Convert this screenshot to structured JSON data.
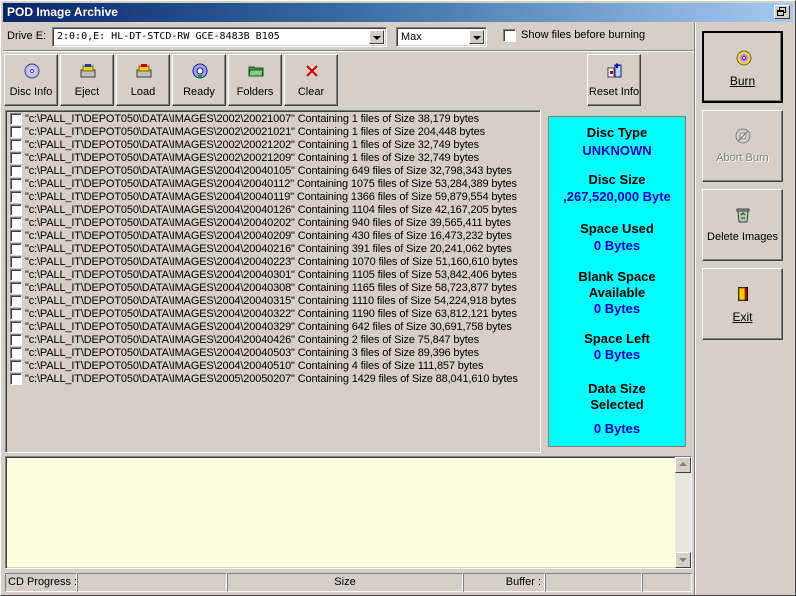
{
  "window": {
    "title": "POD Image Archive"
  },
  "drive": {
    "label": "Drive E:",
    "selected": "2:0:0,E: HL-DT-STCD-RW GCE-8483B B105"
  },
  "speed": {
    "selected": "Max"
  },
  "show_files": {
    "label": "Show files before burning",
    "checked": false
  },
  "toolbar": {
    "disc_info": "Disc Info",
    "eject": "Eject",
    "load": "Load",
    "ready": "Ready",
    "folders": "Folders",
    "clear": "Clear",
    "reset_info": "Reset Info"
  },
  "files": [
    "\"c:\\PALL_IT\\DEPOT050\\DATA\\IMAGES\\2002\\20021007\" Containing 1 files of Size 38,179 bytes",
    "\"c:\\PALL_IT\\DEPOT050\\DATA\\IMAGES\\2002\\20021021\" Containing 1 files of Size 204,448 bytes",
    "\"c:\\PALL_IT\\DEPOT050\\DATA\\IMAGES\\2002\\20021202\" Containing 1 files of Size 32,749 bytes",
    "\"c:\\PALL_IT\\DEPOT050\\DATA\\IMAGES\\2002\\20021209\" Containing 1 files of Size 32,749 bytes",
    "\"c:\\PALL_IT\\DEPOT050\\DATA\\IMAGES\\2004\\20040105\" Containing 649 files of Size 32,798,343 bytes",
    "\"c:\\PALL_IT\\DEPOT050\\DATA\\IMAGES\\2004\\20040112\" Containing 1075 files of Size 53,284,389 bytes",
    "\"c:\\PALL_IT\\DEPOT050\\DATA\\IMAGES\\2004\\20040119\" Containing 1366 files of Size 59,879,554 bytes",
    "\"c:\\PALL_IT\\DEPOT050\\DATA\\IMAGES\\2004\\20040126\" Containing 1104 files of Size 42,167,205 bytes",
    "\"c:\\PALL_IT\\DEPOT050\\DATA\\IMAGES\\2004\\20040202\" Containing 940 files of Size 39,565,411 bytes",
    "\"c:\\PALL_IT\\DEPOT050\\DATA\\IMAGES\\2004\\20040209\" Containing 430 files of Size 16,473,232 bytes",
    "\"c:\\PALL_IT\\DEPOT050\\DATA\\IMAGES\\2004\\20040216\" Containing 391 files of Size 20,241,062 bytes",
    "\"c:\\PALL_IT\\DEPOT050\\DATA\\IMAGES\\2004\\20040223\" Containing 1070 files of Size 51,160,610 bytes",
    "\"c:\\PALL_IT\\DEPOT050\\DATA\\IMAGES\\2004\\20040301\" Containing 1105 files of Size 53,842,406 bytes",
    "\"c:\\PALL_IT\\DEPOT050\\DATA\\IMAGES\\2004\\20040308\" Containing 1165 files of Size 58,723,877 bytes",
    "\"c:\\PALL_IT\\DEPOT050\\DATA\\IMAGES\\2004\\20040315\" Containing 1110 files of Size 54,224,918 bytes",
    "\"c:\\PALL_IT\\DEPOT050\\DATA\\IMAGES\\2004\\20040322\" Containing 1190 files of Size 63,812,121 bytes",
    "\"c:\\PALL_IT\\DEPOT050\\DATA\\IMAGES\\2004\\20040329\" Containing 642 files of Size 30,691,758 bytes",
    "\"c:\\PALL_IT\\DEPOT050\\DATA\\IMAGES\\2004\\20040426\" Containing 2 files of Size 75,847 bytes",
    "\"c:\\PALL_IT\\DEPOT050\\DATA\\IMAGES\\2004\\20040503\" Containing 3 files of Size 89,396 bytes",
    "\"c:\\PALL_IT\\DEPOT050\\DATA\\IMAGES\\2004\\20040510\" Containing 4 files of Size 111,857 bytes",
    "\"c:\\PALL_IT\\DEPOT050\\DATA\\IMAGES\\2005\\20050207\" Containing 1429 files of Size 88,041,610 bytes"
  ],
  "disc_panel": {
    "disc_type_label": "Disc Type",
    "disc_type_value": "UNKNOWN",
    "disc_size_label": "Disc Size",
    "disc_size_value": ",267,520,000 Byte",
    "space_used_label": "Space Used",
    "space_used_value": "0 Bytes",
    "blank_space_label_1": "Blank Space",
    "blank_space_label_2": "Available",
    "blank_space_value": "0 Bytes",
    "space_left_label": "Space Left",
    "space_left_value": "0 Bytes",
    "data_size_label_1": "Data Size",
    "data_size_label_2": "Selected",
    "data_size_value": "0 Bytes",
    "background_color": "#00ffff",
    "value_color": "#0000c0"
  },
  "side_buttons": {
    "burn": "Burn",
    "abort_burn": "Abort Burn",
    "delete_images": "Delete Images",
    "exit": "Exit"
  },
  "status": {
    "cd_progress_label": "CD Progress :",
    "size_label": "Size",
    "buffer_label": "Buffer :"
  },
  "icons": {
    "disc_info": "cd-icon",
    "eject": "eject-icon",
    "load": "load-icon",
    "ready": "cd-ready-icon",
    "folders": "folder-icon",
    "clear": "red-x-icon",
    "reset_info": "reset-icon",
    "burn": "burn-cd-icon",
    "abort_burn": "abort-icon",
    "delete_images": "recycle-bin-icon",
    "exit": "door-exit-icon"
  }
}
